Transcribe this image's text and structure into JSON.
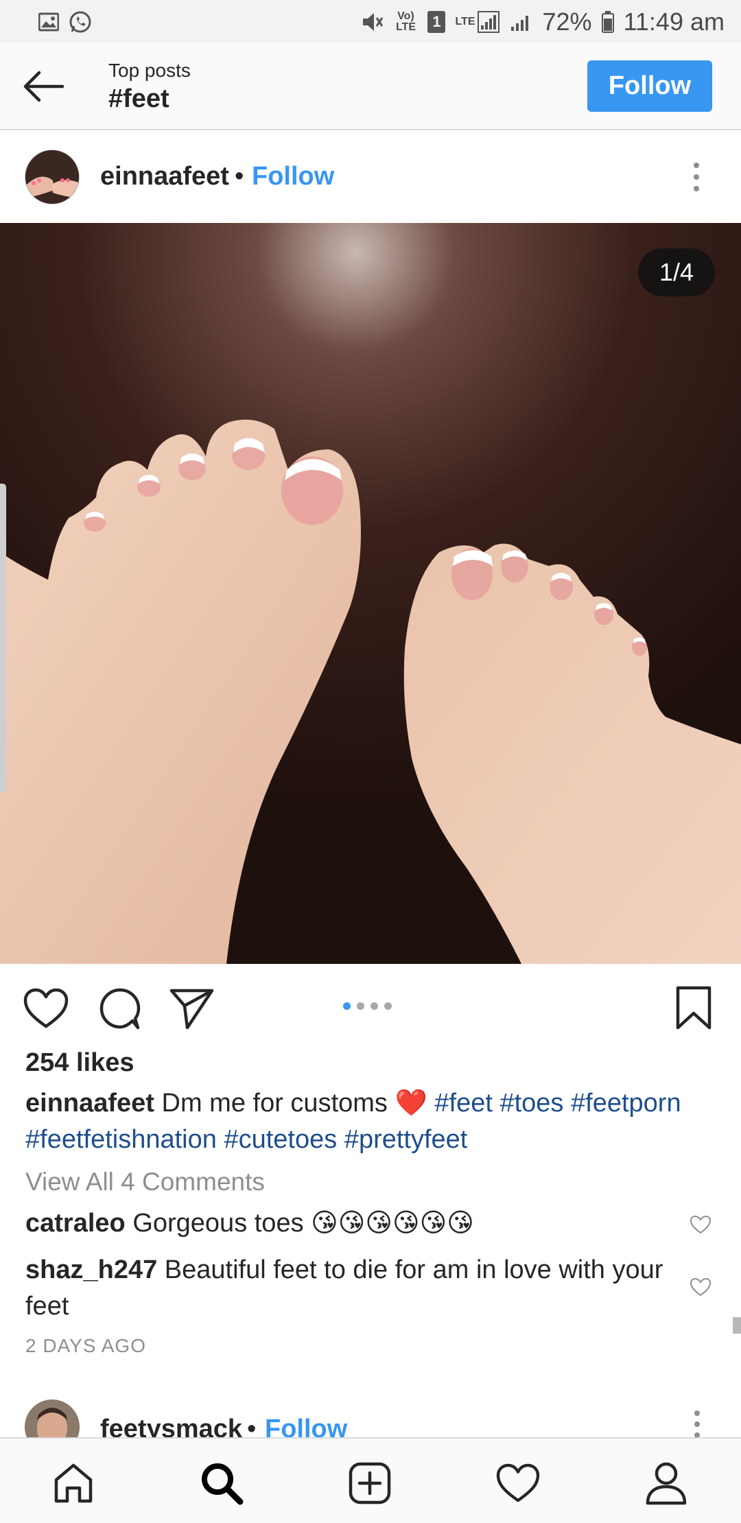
{
  "status_bar": {
    "left_icons": [
      "image-icon",
      "whatsapp-icon"
    ],
    "right_icons": [
      "mute-icon",
      "volte-icon",
      "sim-icon",
      "lte-signal-icon",
      "signal-icon"
    ],
    "volte_label": "Vo) LTE",
    "sim_label": "1",
    "lte_label": "LTE",
    "battery": "72%",
    "time": "11:49 am"
  },
  "header": {
    "subtitle": "Top posts",
    "title": "#feet",
    "follow_label": "Follow",
    "accent": "#3897f0"
  },
  "post": {
    "username": "einnaafeet",
    "separator": "•",
    "follow_label": "Follow",
    "counter": "1/4",
    "carousel": {
      "total": 4,
      "active": 1
    },
    "likes": "254 likes",
    "caption": {
      "username": "einnaafeet",
      "text": "Dm me for customs",
      "emoji": "❤️",
      "hashtags": [
        "#feet",
        "#toes",
        "#feetporn",
        "#feetfetishnation",
        "#cutetoes",
        "#prettyfeet"
      ]
    },
    "view_comments": "View All 4 Comments",
    "comments": [
      {
        "username": "catraleo",
        "text": "Gorgeous toes",
        "emoji": "😘😘😘😘😘😘"
      },
      {
        "username": "shaz_h247",
        "text": "Beautiful  feet to die for am in love with your feet"
      }
    ],
    "timestamp": "2 DAYS AGO",
    "hashtag_color": "#1e4e8c"
  },
  "next_post": {
    "username": "feetysmack",
    "separator": "•",
    "follow_label": "Follow"
  },
  "bottom_nav": [
    "home-icon",
    "search-icon",
    "add-icon",
    "activity-heart-icon",
    "profile-icon"
  ]
}
